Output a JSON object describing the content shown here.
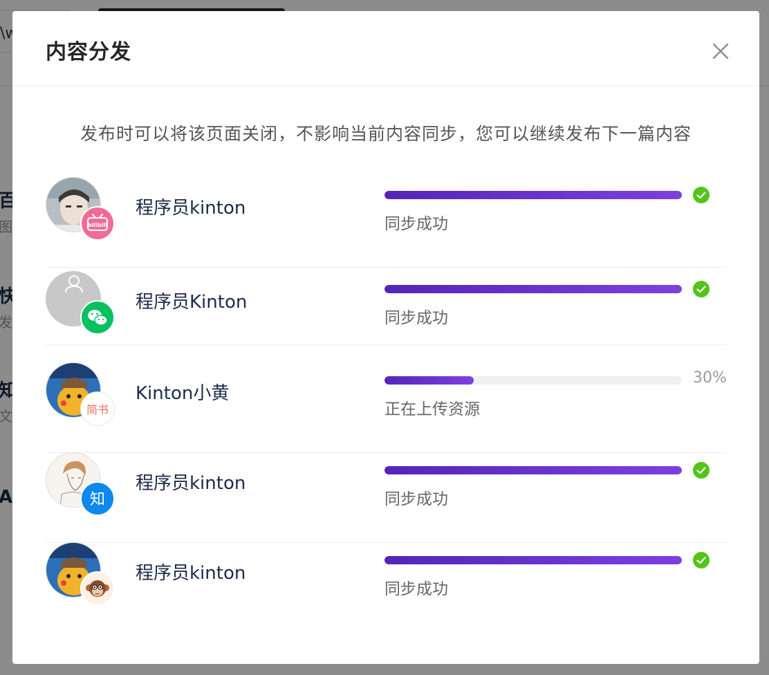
{
  "background": {
    "input_fragment": "\\w",
    "left_edge_chars": [
      "百",
      "快",
      "知",
      "Ac"
    ],
    "left_edge_subs": [
      "图",
      "发",
      "文"
    ]
  },
  "modal": {
    "title": "内容分发",
    "close_icon": "close-icon",
    "notice": "发布时可以将该页面关闭，不影响当前内容同步，您可以继续发布下一篇内容"
  },
  "accounts": [
    {
      "name": "程序员kinton",
      "platform_icon": "bilibili-icon",
      "platform_label": "bilibili",
      "progress": 1.0,
      "status": "同步成功",
      "done": true
    },
    {
      "name": "程序员Kinton",
      "platform_icon": "wechat-icon",
      "progress": 1.0,
      "status": "同步成功",
      "done": true
    },
    {
      "name": "Kinton小黄",
      "platform_icon": "jianshu-icon",
      "platform_label": "简书",
      "progress": 0.3,
      "percent_text": "30%",
      "status": "正在上传资源",
      "done": false
    },
    {
      "name": "程序员kinton",
      "platform_icon": "zhihu-icon",
      "platform_label": "知",
      "progress": 1.0,
      "status": "同步成功",
      "done": true
    },
    {
      "name": "程序员kinton",
      "platform_icon": "juejin-monkey-icon",
      "progress": 1.0,
      "status": "同步成功",
      "done": true
    }
  ],
  "colors": {
    "progress_start": "#5425b8",
    "progress_end": "#7e3fe0",
    "success": "#52c41a",
    "bilibili": "#f06b98",
    "wechat": "#07c160",
    "zhihu": "#0f88eb",
    "jianshu": "#ea6f5a"
  }
}
